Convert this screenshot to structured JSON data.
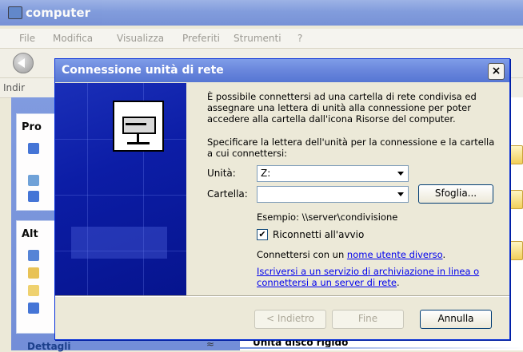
{
  "background": {
    "window_title": "computer",
    "menu": [
      "File",
      "Modifica",
      "Visualizza",
      "Preferiti",
      "Strumenti",
      "?"
    ],
    "address_label": "Indir",
    "panel_tasks_header": "Pro",
    "panel_other_header": "Alt",
    "details_header": "Dettagli",
    "details_chevron": "≈",
    "section_hard_disks": "Unità disco rigido"
  },
  "dialog": {
    "title": "Connessione unità di rete",
    "close_label": "×",
    "intro": "È possibile connettersi ad una cartella di rete condivisa ed assegnare una lettera di unità alla connessione per poter accedere alla cartella dall'icona Risorse del computer.",
    "instruction": "Specificare la lettera dell'unità per la connessione e la cartella a cui connettersi:",
    "drive_label": "Unità:",
    "drive_value": "Z:",
    "folder_label": "Cartella:",
    "folder_value": "",
    "browse_label": "Sfoglia...",
    "example": "Esempio: \\\\server\\condivisione",
    "reconnect_label": "Riconnetti all'avvio",
    "reconnect_checked": "✔",
    "connect_as_prefix": "Connettersi con un ",
    "connect_as_link": "nome utente diverso",
    "connect_as_suffix": ".",
    "signup_link": "Iscriversi a un servizio di archiviazione in linea o connettersi a un server di rete",
    "signup_suffix": ".",
    "back_label": "< Indietro",
    "finish_label": "Fine",
    "cancel_label": "Annulla"
  }
}
